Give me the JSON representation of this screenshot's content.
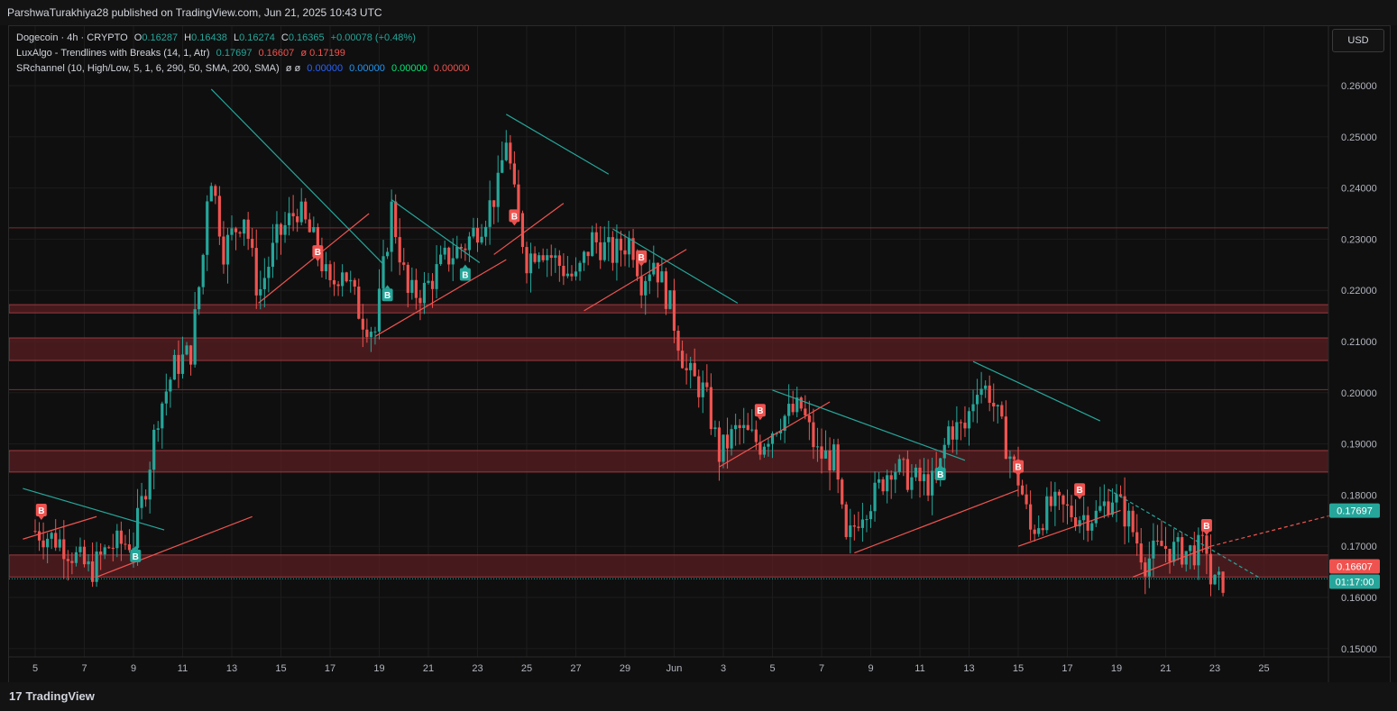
{
  "header": {
    "published": "ParshwaTurakhiya28 published on TradingView.com, Jun 21, 2025 10:43 UTC"
  },
  "legend": {
    "symbol": "Dogecoin · 4h · CRYPTO",
    "o_label": "O",
    "o": "0.16287",
    "h_label": "H",
    "h": "0.16438",
    "l_label": "L",
    "l": "0.16274",
    "c_label": "C",
    "c": "0.16365",
    "change": "+0.00078 (+0.48%)",
    "ind1_name": "LuxAlgo - Trendlines with Breaks (14, 1, Atr)",
    "ind1_v1": "0.17697",
    "ind1_v2": "0.16607",
    "ind1_v3": "ø 0.17199",
    "ind2_name": "SRchannel (10, High/Low, 5, 1, 6, 290, 50, SMA, 200, SMA)",
    "ind2_flags": "ø ø",
    "ind2_v1": "0.00000",
    "ind2_v2": "0.00000",
    "ind2_v3": "0.00000",
    "ind2_v4": "0.00000"
  },
  "currency_button": "USD",
  "footer": {
    "brand": "TradingView",
    "logo_glyph": "17"
  },
  "colors": {
    "up": "#26a69a",
    "down": "#ef5350",
    "zone": "#5a1f23",
    "trend_down": "#26a69a",
    "trend_up": "#ef5350",
    "background": "#0f0f0f"
  },
  "chart_data": {
    "type": "candlestick",
    "title": "Dogecoin · 4h · CRYPTO",
    "ylim": [
      0.145,
      0.265
    ],
    "y_ticks": [
      "0.26000",
      "0.25000",
      "0.24000",
      "0.23000",
      "0.22000",
      "0.21000",
      "0.20000",
      "0.19000",
      "0.18000",
      "0.17000",
      "0.16000",
      "0.15000"
    ],
    "x_ticks": [
      "5",
      "7",
      "9",
      "11",
      "13",
      "15",
      "17",
      "19",
      "21",
      "23",
      "25",
      "27",
      "29",
      "Jun",
      "3",
      "5",
      "7",
      "9",
      "11",
      "13",
      "15",
      "17",
      "19",
      "21",
      "23",
      "25"
    ],
    "close_path": [
      [
        "2025-05-04 00:00",
        0.173
      ],
      [
        "2025-05-05 00:00",
        0.171
      ],
      [
        "2025-05-06 06:00",
        0.165
      ],
      [
        "2025-05-07 00:00",
        0.17
      ],
      [
        "2025-05-08 00:00",
        0.171
      ],
      [
        "2025-05-08 12:00",
        0.182
      ],
      [
        "2025-05-09 00:00",
        0.196
      ],
      [
        "2025-05-09 16:00",
        0.205
      ],
      [
        "2025-05-10 08:00",
        0.208
      ],
      [
        "2025-05-10 20:00",
        0.227
      ],
      [
        "2025-05-11 02:00",
        0.245
      ],
      [
        "2025-05-11 16:00",
        0.228
      ],
      [
        "2025-05-12 12:00",
        0.235
      ],
      [
        "2025-05-13 02:00",
        0.219
      ],
      [
        "2025-05-13 20:00",
        0.23
      ],
      [
        "2025-05-14 16:00",
        0.236
      ],
      [
        "2025-05-15 12:00",
        0.228
      ],
      [
        "2025-05-16 00:00",
        0.22
      ],
      [
        "2025-05-16 12:00",
        0.225
      ],
      [
        "2025-05-17 06:00",
        0.215
      ],
      [
        "2025-05-17 20:00",
        0.212
      ],
      [
        "2025-05-18 12:00",
        0.236
      ],
      [
        "2025-05-19 04:00",
        0.219
      ],
      [
        "2025-05-19 20:00",
        0.22
      ],
      [
        "2025-05-20 16:00",
        0.226
      ],
      [
        "2025-05-21 12:00",
        0.229
      ],
      [
        "2025-05-22 06:00",
        0.234
      ],
      [
        "2025-05-22 20:00",
        0.24
      ],
      [
        "2025-05-23 04:00",
        0.25
      ],
      [
        "2025-05-23 12:00",
        0.238
      ],
      [
        "2025-05-24 00:00",
        0.226
      ],
      [
        "2025-05-24 12:00",
        0.229
      ],
      [
        "2025-05-25 08:00",
        0.225
      ],
      [
        "2025-05-26 00:00",
        0.222
      ],
      [
        "2025-05-26 16:00",
        0.23
      ],
      [
        "2025-05-27 12:00",
        0.227
      ],
      [
        "2025-05-28 06:00",
        0.23
      ],
      [
        "2025-05-28 16:00",
        0.222
      ],
      [
        "2025-05-29 04:00",
        0.226
      ],
      [
        "2025-05-29 20:00",
        0.217
      ],
      [
        "2025-05-30 12:00",
        0.204
      ],
      [
        "2025-05-31 06:00",
        0.2
      ],
      [
        "2025-05-31 20:00",
        0.188
      ],
      [
        "2025-06-01 14:00",
        0.193
      ],
      [
        "2025-06-02 12:00",
        0.19
      ],
      [
        "2025-06-03 08:00",
        0.195
      ],
      [
        "2025-06-04 04:00",
        0.197
      ],
      [
        "2025-06-04 20:00",
        0.188
      ],
      [
        "2025-06-05 12:00",
        0.187
      ],
      [
        "2025-06-06 00:00",
        0.17
      ],
      [
        "2025-06-06 14:00",
        0.177
      ],
      [
        "2025-06-07 04:00",
        0.18
      ],
      [
        "2025-06-07 20:00",
        0.186
      ],
      [
        "2025-06-08 16:00",
        0.183
      ],
      [
        "2025-06-09 16:00",
        0.182
      ],
      [
        "2025-06-10 04:00",
        0.193
      ],
      [
        "2025-06-10 20:00",
        0.193
      ],
      [
        "2025-06-11 08:00",
        0.202
      ],
      [
        "2025-06-11 20:00",
        0.2
      ],
      [
        "2025-06-12 12:00",
        0.19
      ],
      [
        "2025-06-13 02:00",
        0.182
      ],
      [
        "2025-06-13 12:00",
        0.173
      ],
      [
        "2025-06-14 08:00",
        0.178
      ],
      [
        "2025-06-15 12:00",
        0.176
      ],
      [
        "2025-06-16 04:00",
        0.176
      ],
      [
        "2025-06-16 20:00",
        0.18
      ],
      [
        "2025-06-17 12:00",
        0.175
      ],
      [
        "2025-06-18 04:00",
        0.167
      ],
      [
        "2025-06-18 20:00",
        0.17
      ],
      [
        "2025-06-19 12:00",
        0.169
      ],
      [
        "2025-06-20 04:00",
        0.169
      ],
      [
        "2025-06-20 16:00",
        0.17
      ],
      [
        "2025-06-20 20:00",
        0.163
      ],
      [
        "2025-06-21 02:00",
        0.162
      ],
      [
        "2025-06-21 10:00",
        0.1637
      ]
    ],
    "ohlc_last": {
      "open": 0.16287,
      "high": 0.16438,
      "low": 0.16274,
      "close": 0.16365
    },
    "resistance_zones": [
      [
        0.2156,
        0.2172
      ],
      [
        0.2063,
        0.2107
      ],
      [
        0.1845,
        0.1887
      ],
      [
        0.164,
        0.1683
      ]
    ],
    "horizontal_lines": [
      0.2322,
      0.2006
    ],
    "current_price_line": 0.16365,
    "trendlines_down": [
      [
        [
          "2025-05-03 12:00",
          0.1813
        ],
        [
          "2025-05-09 06:00",
          0.1732
        ]
      ],
      [
        [
          "2025-05-11 04:00",
          0.2593
        ],
        [
          "2025-05-18 04:00",
          0.2251
        ]
      ],
      [
        [
          "2025-05-18 12:00",
          0.2377
        ],
        [
          "2025-05-22 02:00",
          0.2254
        ]
      ],
      [
        [
          "2025-05-23 04:00",
          0.2544
        ],
        [
          "2025-05-27 08:00",
          0.2427
        ]
      ],
      [
        [
          "2025-05-27 12:00",
          0.232
        ],
        [
          "2025-06-01 14:00",
          0.2175
        ]
      ],
      [
        [
          "2025-06-03 00:00",
          0.2005
        ],
        [
          "2025-06-10 20:00",
          0.1868
        ]
      ],
      [
        [
          "2025-06-11 04:00",
          0.2061
        ],
        [
          "2025-06-16 08:00",
          0.1945
        ]
      ],
      [
        [
          "2025-06-16 16:00",
          0.1811
        ],
        [
          "2025-06-22 20:00",
          0.1638
        ]
      ]
    ],
    "trendlines_up": [
      [
        [
          "2025-05-03 12:00",
          0.1714
        ],
        [
          "2025-05-06 12:00",
          0.1758
        ]
      ],
      [
        [
          "2025-05-06 12:00",
          0.164
        ],
        [
          "2025-05-12 20:00",
          0.1758
        ]
      ],
      [
        [
          "2025-05-13 02:00",
          0.2175
        ],
        [
          "2025-05-17 14:00",
          0.235
        ]
      ],
      [
        [
          "2025-05-17 20:00",
          0.211
        ],
        [
          "2025-05-23 04:00",
          0.226
        ]
      ],
      [
        [
          "2025-05-22 16:00",
          0.227
        ],
        [
          "2025-05-25 12:00",
          0.237
        ]
      ],
      [
        [
          "2025-05-26 08:00",
          0.216
        ],
        [
          "2025-05-30 12:00",
          0.228
        ]
      ],
      [
        [
          "2025-05-31 20:00",
          0.1855
        ],
        [
          "2025-06-05 08:00",
          0.1982
        ]
      ],
      [
        [
          "2025-06-06 08:00",
          0.1687
        ],
        [
          "2025-06-13 00:00",
          0.181
        ]
      ],
      [
        [
          "2025-06-13 00:00",
          0.17
        ],
        [
          "2025-06-17 04:00",
          0.177
        ]
      ],
      [
        [
          "2025-06-17 16:00",
          0.164
        ],
        [
          "2025-06-20 20:00",
          0.17
        ]
      ],
      [
        [
          "2025-06-20 20:00",
          0.17
        ],
        [
          "2025-06-26 12:00",
          0.177
        ]
      ]
    ],
    "signals": [
      {
        "type": "sell",
        "label": "B",
        "time": "2025-05-04 06:00",
        "price": 0.1755
      },
      {
        "type": "buy",
        "label": "B",
        "time": "2025-05-08 02:00",
        "price": 0.169
      },
      {
        "type": "sell",
        "label": "B",
        "time": "2025-05-15 12:00",
        "price": 0.226
      },
      {
        "type": "buy",
        "label": "B",
        "time": "2025-05-18 08:00",
        "price": 0.22
      },
      {
        "type": "buy",
        "label": "B",
        "time": "2025-05-21 12:00",
        "price": 0.224
      },
      {
        "type": "sell",
        "label": "B",
        "time": "2025-05-23 12:00",
        "price": 0.233
      },
      {
        "type": "sell",
        "label": "B",
        "time": "2025-05-28 16:00",
        "price": 0.225
      },
      {
        "type": "sell",
        "label": "B",
        "time": "2025-06-02 12:00",
        "price": 0.195
      },
      {
        "type": "buy",
        "label": "B",
        "time": "2025-06-09 20:00",
        "price": 0.185
      },
      {
        "type": "sell",
        "label": "B",
        "time": "2025-06-13 00:00",
        "price": 0.184
      },
      {
        "type": "sell",
        "label": "B",
        "time": "2025-06-15 12:00",
        "price": 0.1795
      },
      {
        "type": "sell",
        "label": "B",
        "time": "2025-06-20 16:00",
        "price": 0.1725
      }
    ],
    "price_labels": [
      {
        "text": "0.17697",
        "value": 0.17697,
        "color": "#26a69a"
      },
      {
        "text": "0.16607",
        "value": 0.16607,
        "color": "#ef5350"
      },
      {
        "text": "01:17:00",
        "value": 0.16365,
        "color": "#26a69a"
      }
    ]
  }
}
